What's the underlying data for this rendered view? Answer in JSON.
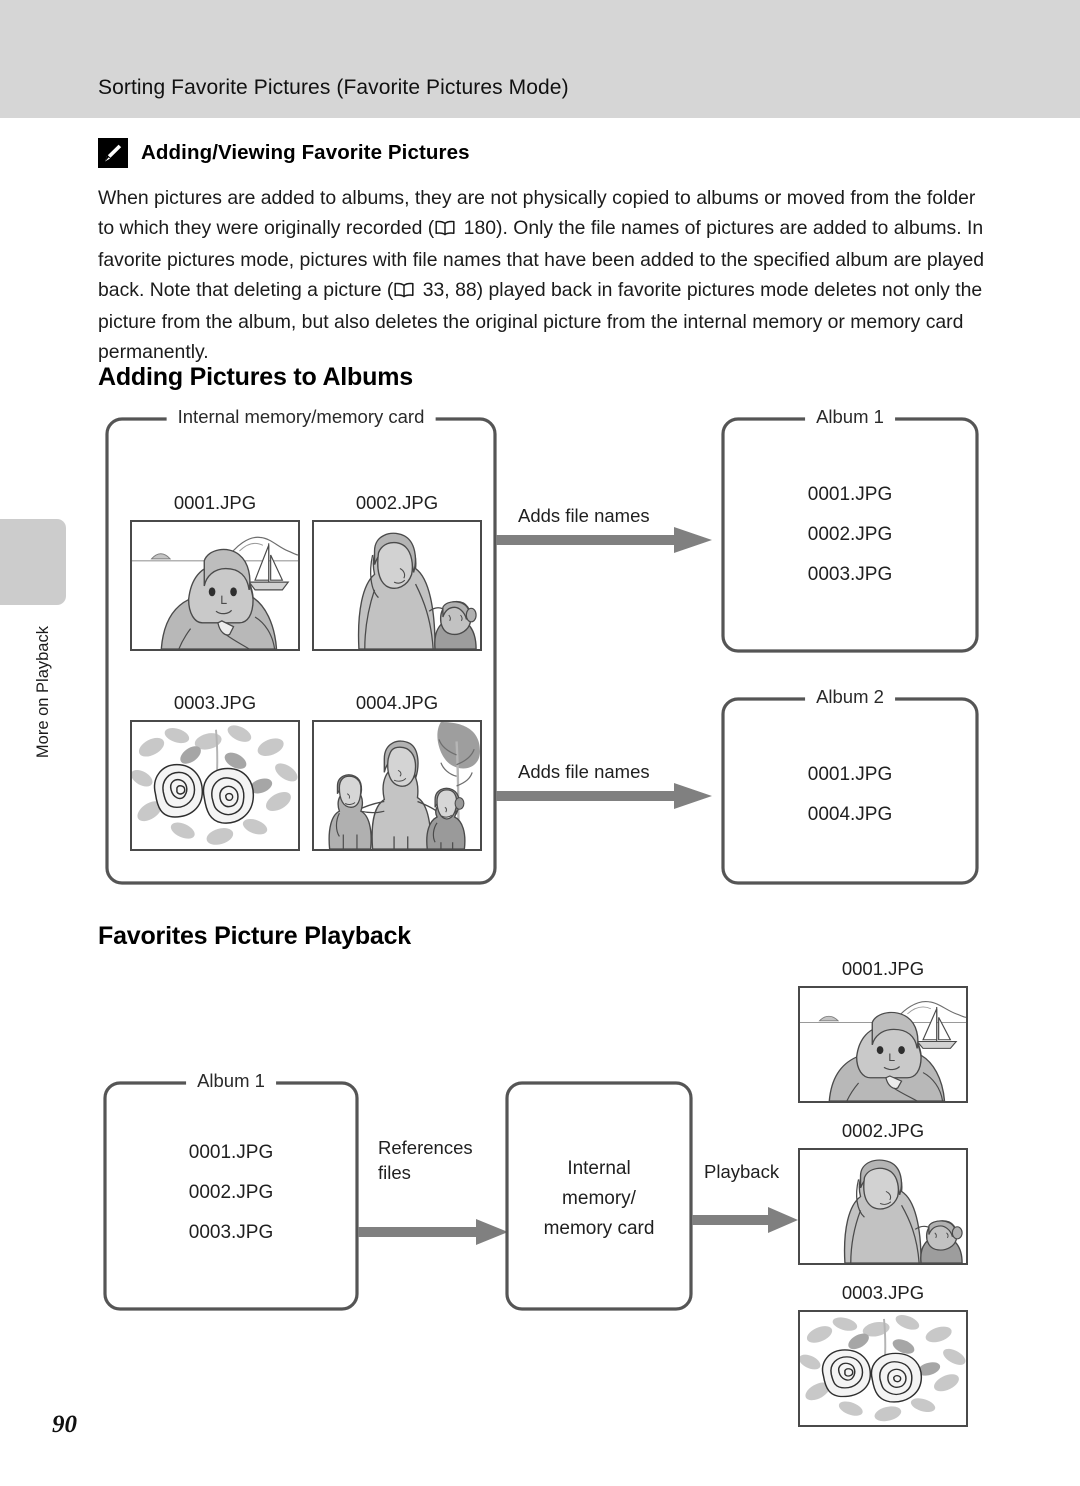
{
  "header": {
    "title": "Sorting Favorite Pictures (Favorite Pictures Mode)"
  },
  "note": {
    "icon": "pencil-icon",
    "title": "Adding/Viewing Favorite Pictures",
    "paragraph_parts": {
      "p1": "When pictures are added to albums, they are not physically copied to albums or moved from the folder to which they were originally recorded (",
      "ref1": "180",
      "p2": "). Only the file names of pictures are added to albums. In favorite pictures mode, pictures with file names that have been added to the specified album are played back. Note that deleting a picture (",
      "ref2": "33, 88",
      "p3": ") played back in favorite pictures mode deletes not only the picture from the album, but also deletes the original picture from the internal memory or memory card permanently."
    }
  },
  "sections": {
    "adding_title": "Adding Pictures to Albums",
    "playback_title": "Favorites Picture Playback"
  },
  "diagram1": {
    "source_box": {
      "label": "Internal memory/memory card"
    },
    "thumbnails": [
      {
        "caption": "0001.JPG",
        "art": "woman-seaside-sailboat"
      },
      {
        "caption": "0002.JPG",
        "art": "woman-and-child"
      },
      {
        "caption": "0003.JPG",
        "art": "roses-flowers"
      },
      {
        "caption": "0004.JPG",
        "art": "family-three-tree"
      }
    ],
    "arrow1_label": "Adds file names",
    "arrow2_label": "Adds file names",
    "album1": {
      "label": "Album 1",
      "files": [
        "0001.JPG",
        "0002.JPG",
        "0003.JPG"
      ]
    },
    "album2": {
      "label": "Album 2",
      "files": [
        "0001.JPG",
        "0004.JPG"
      ]
    }
  },
  "diagram2": {
    "album": {
      "label": "Album 1",
      "files": [
        "0001.JPG",
        "0002.JPG",
        "0003.JPG"
      ]
    },
    "arrow1_label": "References\nfiles",
    "memory_box": {
      "line1": "Internal",
      "line2": "memory/",
      "line3": "memory card"
    },
    "arrow2_label": "Playback",
    "thumbnails": [
      {
        "caption": "0001.JPG",
        "art": "woman-seaside-sailboat"
      },
      {
        "caption": "0002.JPG",
        "art": "woman-and-child"
      },
      {
        "caption": "0003.JPG",
        "art": "roses-flowers"
      }
    ]
  },
  "sidebar": {
    "tab_label": "More on Playback"
  },
  "footer": {
    "page_number": "90"
  },
  "colors": {
    "header_band": "#d6d6d6",
    "arrow": "#808080",
    "box_stroke": "#555555",
    "tab_block": "#cccccc"
  }
}
